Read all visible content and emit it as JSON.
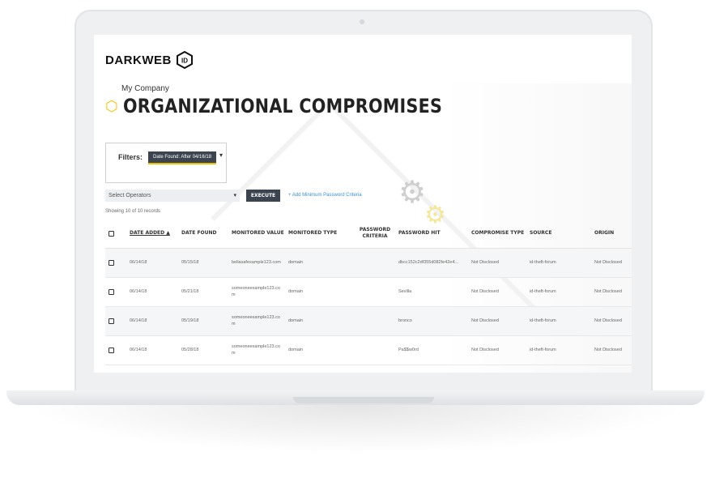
{
  "brand": {
    "name": "DARKWEB",
    "badge": "ID"
  },
  "header": {
    "company": "My Company",
    "title": "ORGANIZATIONAL COMPROMISES"
  },
  "filters": {
    "label": "Filters:",
    "chip": "Date Found: After 04/16/18"
  },
  "operator": {
    "placeholder": "Select Operators",
    "execute": "EXECUTE",
    "add_criteria": "+ Add Minimum Password Criteria"
  },
  "records": {
    "showing": "Showing 10 of 10 records"
  },
  "table": {
    "columns": [
      "DATE ADDED",
      "DATE FOUND",
      "MONITORED VALUE",
      "MONITORED TYPE",
      "PASSWORD CRITERIA",
      "PASSWORD HIT",
      "COMPROMISE TYPE",
      "SOURCE",
      "ORIGIN"
    ],
    "sort_indicator": "▲",
    "rows": [
      {
        "date_added": "06/14/18",
        "date_found": "05/15/18",
        "monitored_value": "bellasafexample123.com",
        "monitored_type": "domain",
        "password_criteria": "",
        "password_hit": "dbcc152c2df355d082fe42e4...",
        "compromise_type": "Not Disclosed",
        "source": "id-theft-forum",
        "origin": "Not Disclosed"
      },
      {
        "date_added": "06/14/18",
        "date_found": "05/21/18",
        "monitored_value": "someoneexample123.com",
        "monitored_type": "domain",
        "password_criteria": "",
        "password_hit": "Sevilla",
        "compromise_type": "Not Disclosed",
        "source": "id-theft-forum",
        "origin": "Not Disclosed"
      },
      {
        "date_added": "06/14/18",
        "date_found": "05/19/18",
        "monitored_value": "someoneexample123.com",
        "monitored_type": "domain",
        "password_criteria": "",
        "password_hit": "bronco",
        "compromise_type": "Not Disclosed",
        "source": "id-theft-forum",
        "origin": "Not Disclosed"
      },
      {
        "date_added": "06/14/18",
        "date_found": "05/28/18",
        "monitored_value": "someoneexample123.com",
        "monitored_type": "domain",
        "password_criteria": "",
        "password_hit": "Pa$$w0rd",
        "compromise_type": "Not Disclosed",
        "source": "id-theft-forum",
        "origin": "Not Disclosed"
      }
    ]
  },
  "colors": {
    "accent": "#f1c40f",
    "button": "#3c4450",
    "link": "#3b8fd4"
  }
}
